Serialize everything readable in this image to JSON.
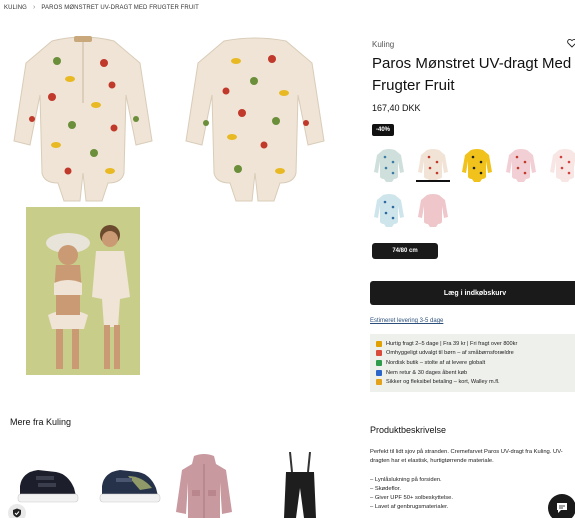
{
  "breadcrumb": {
    "items": [
      "KULING",
      "PAROS MØNSTRET UV-DRAGT MED FRUGTER FRUIT"
    ],
    "separator": "›"
  },
  "product": {
    "brand": "Kuling",
    "title": "Paros Mønstret UV-dragt Med Frugter Fruit",
    "price": "167,40 DKK",
    "discount": "-40%",
    "selected_size": "74/80 cm",
    "add_to_cart": "Læg i indkøbskurv",
    "delivery": "Estimeret levering 3-5 dage"
  },
  "swatches": [
    {
      "name": "swatch-fruit-mint",
      "color": "#cfe0dc",
      "dots": "#3a7ca5"
    },
    {
      "name": "swatch-fruit-cream",
      "color": "#f1e4d6",
      "dots": "#c0392b"
    },
    {
      "name": "swatch-yellow",
      "color": "#f0c21b",
      "dots": "#222"
    },
    {
      "name": "swatch-pink-print",
      "color": "#f2cfd4",
      "dots": "#c0392b"
    },
    {
      "name": "swatch-strawberry",
      "color": "#f7e6e3",
      "dots": "#d14242"
    },
    {
      "name": "swatch-light-blue",
      "color": "#cfe5ec",
      "dots": "#2d6aa0"
    },
    {
      "name": "swatch-rose",
      "color": "#efc6c9",
      "dots": "#efc6c9"
    }
  ],
  "usps": [
    {
      "icon": "lightning-icon",
      "color": "#e0a100",
      "text": "Hurtig fragt 2–5 dage | Fra 39 kr | Fri fragt over 800kr"
    },
    {
      "icon": "heart-icon",
      "color": "#d94a3a",
      "text": "Omhyggeligt udvalgt til børn – af småbørnsforældre"
    },
    {
      "icon": "leaf-icon",
      "color": "#2e9c4a",
      "text": "Nordisk butik – stolte af at levere globalt"
    },
    {
      "icon": "return-icon",
      "color": "#2a66c9",
      "text": "Nem retur & 30 dages åbent køb"
    },
    {
      "icon": "lock-icon",
      "color": "#e3a21a",
      "text": "Sikker og fleksibel betaling – kort, Walley m.fl."
    }
  ],
  "more_from": "Mere fra Kuling",
  "description": {
    "title": "Produktbeskrivelse",
    "intro": "Perfekt til lidt sjov på stranden. Cremefarvet Paros UV-dragt fra Kuling. UV-dragten har et elastisk, hurtigtørrende materiale.",
    "bullets": [
      "– Lynlåslukning på forsiden.",
      "– Skødeflor.",
      "– Giver UPF 50+ solbeskyttelse.",
      "– Lavet af genbrugsmaterialer."
    ]
  },
  "colors": {
    "suit": "#efe4d6",
    "dark": "#1a1a1a",
    "usp_bg": "#eef0ec"
  }
}
